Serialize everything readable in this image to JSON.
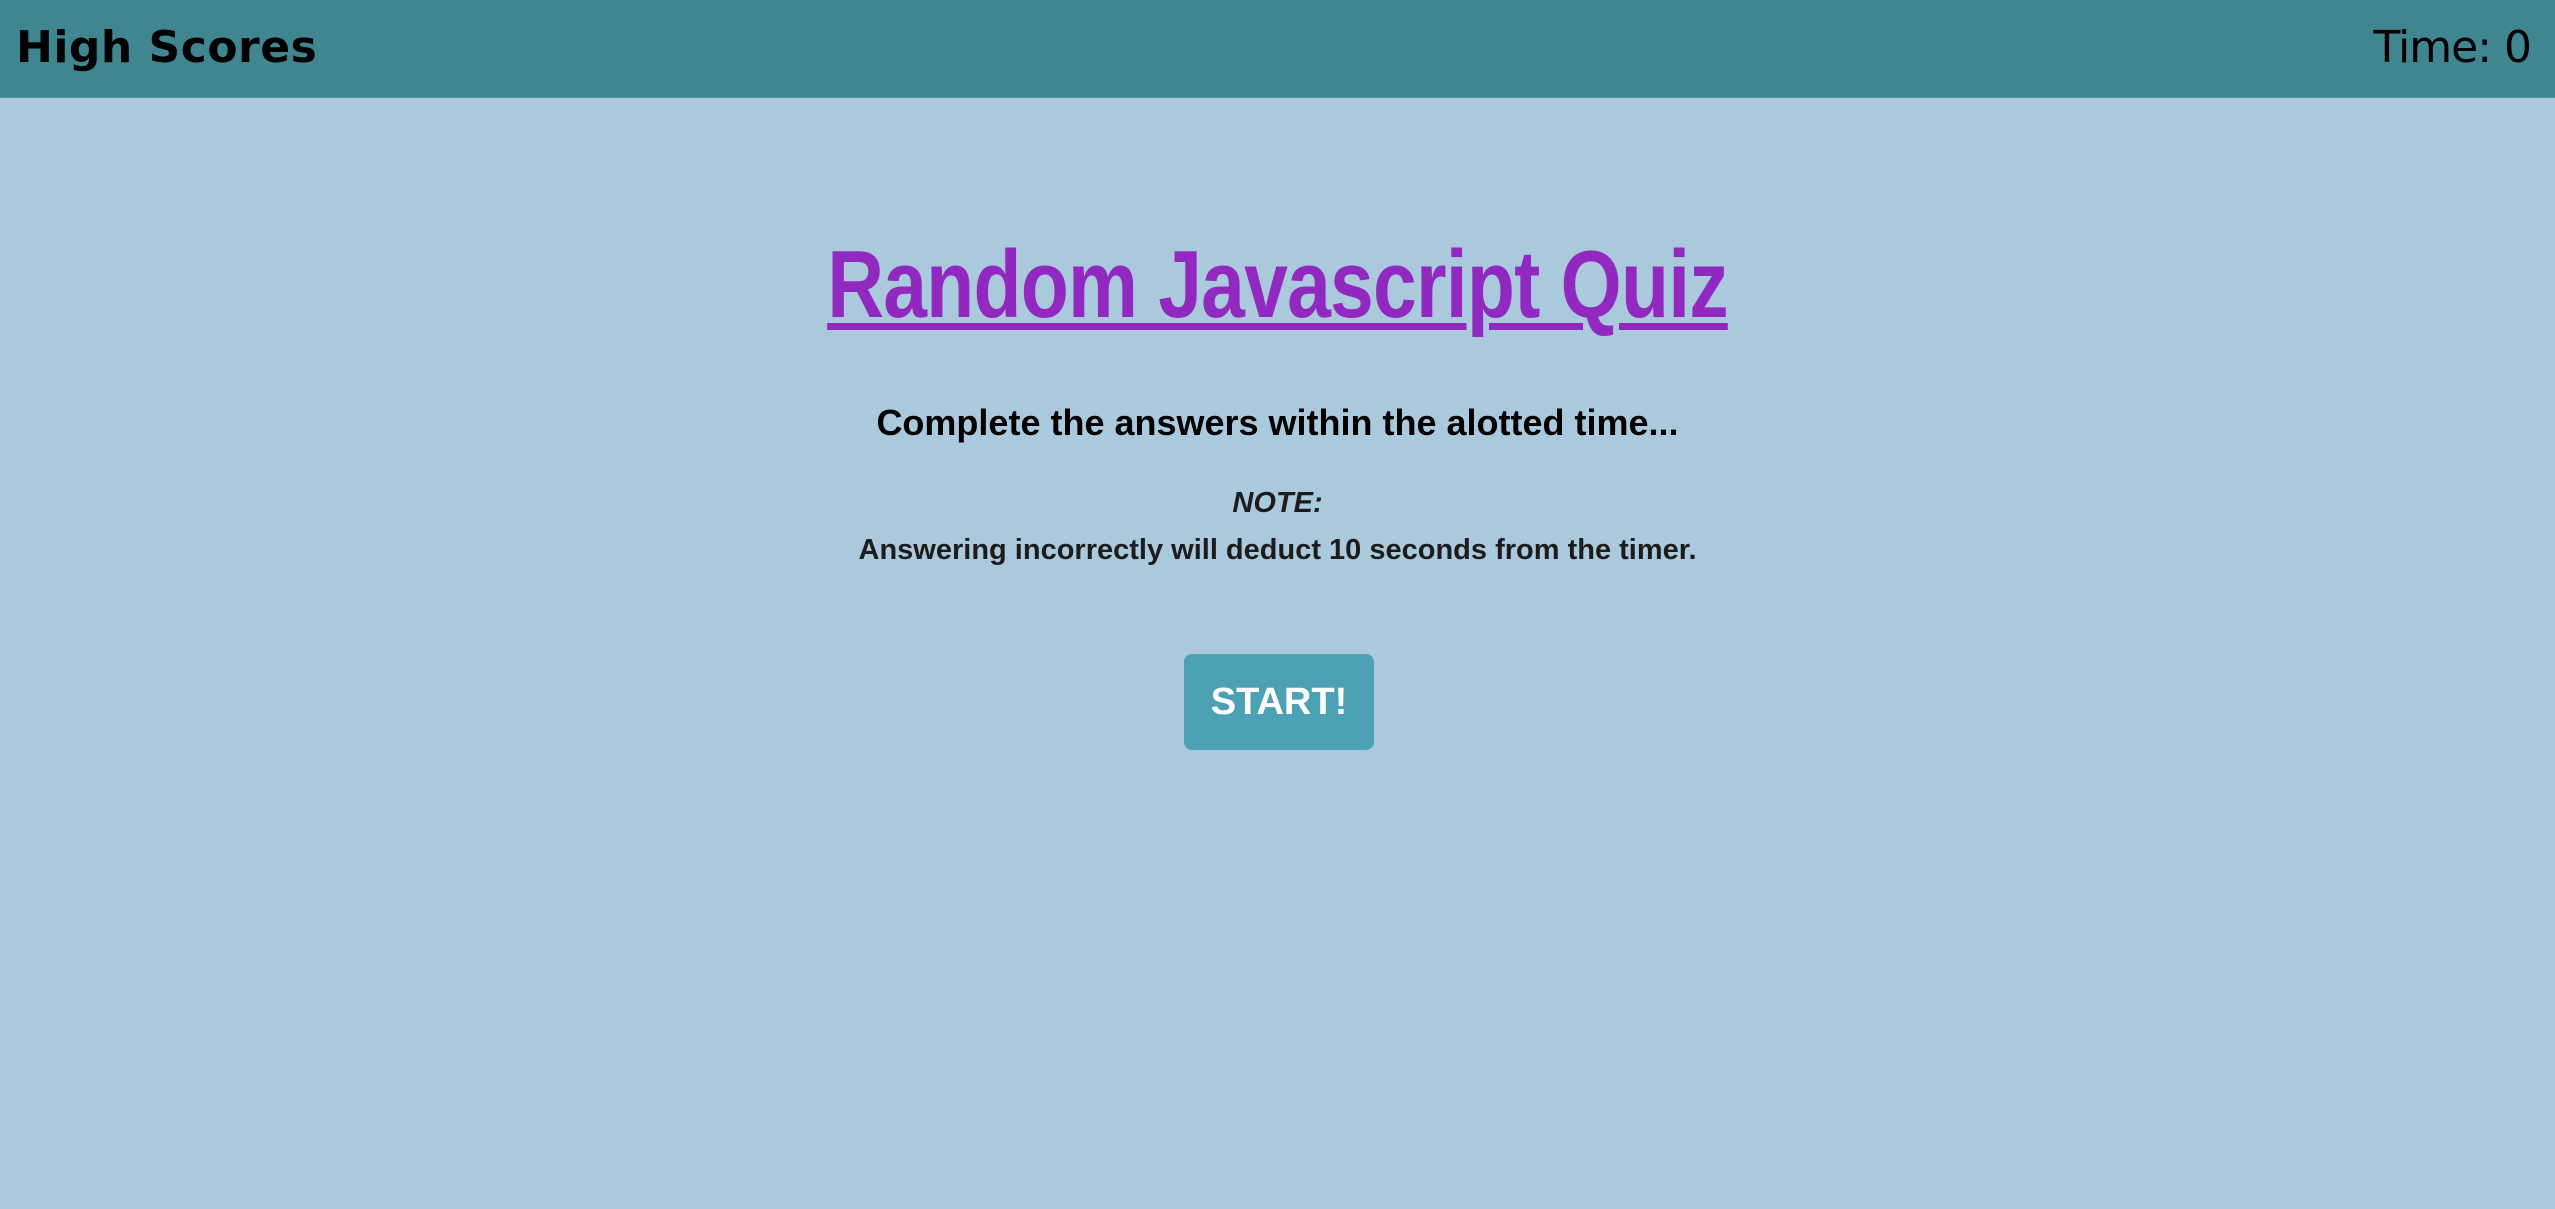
{
  "header": {
    "high_scores_label": "High Scores",
    "timer_text": "Time: 0"
  },
  "main": {
    "title": "Random Javascript Quiz",
    "subtitle": "Complete the answers within the alotted time...",
    "note_label": "NOTE:",
    "note_text": "Answering incorrectly will deduct 10 seconds from the timer.",
    "start_label": "START!"
  },
  "colors": {
    "background": "#abc9dd",
    "header_bar": "#3f8690",
    "title": "#9129c0",
    "start_button": "#4ca2b4"
  }
}
